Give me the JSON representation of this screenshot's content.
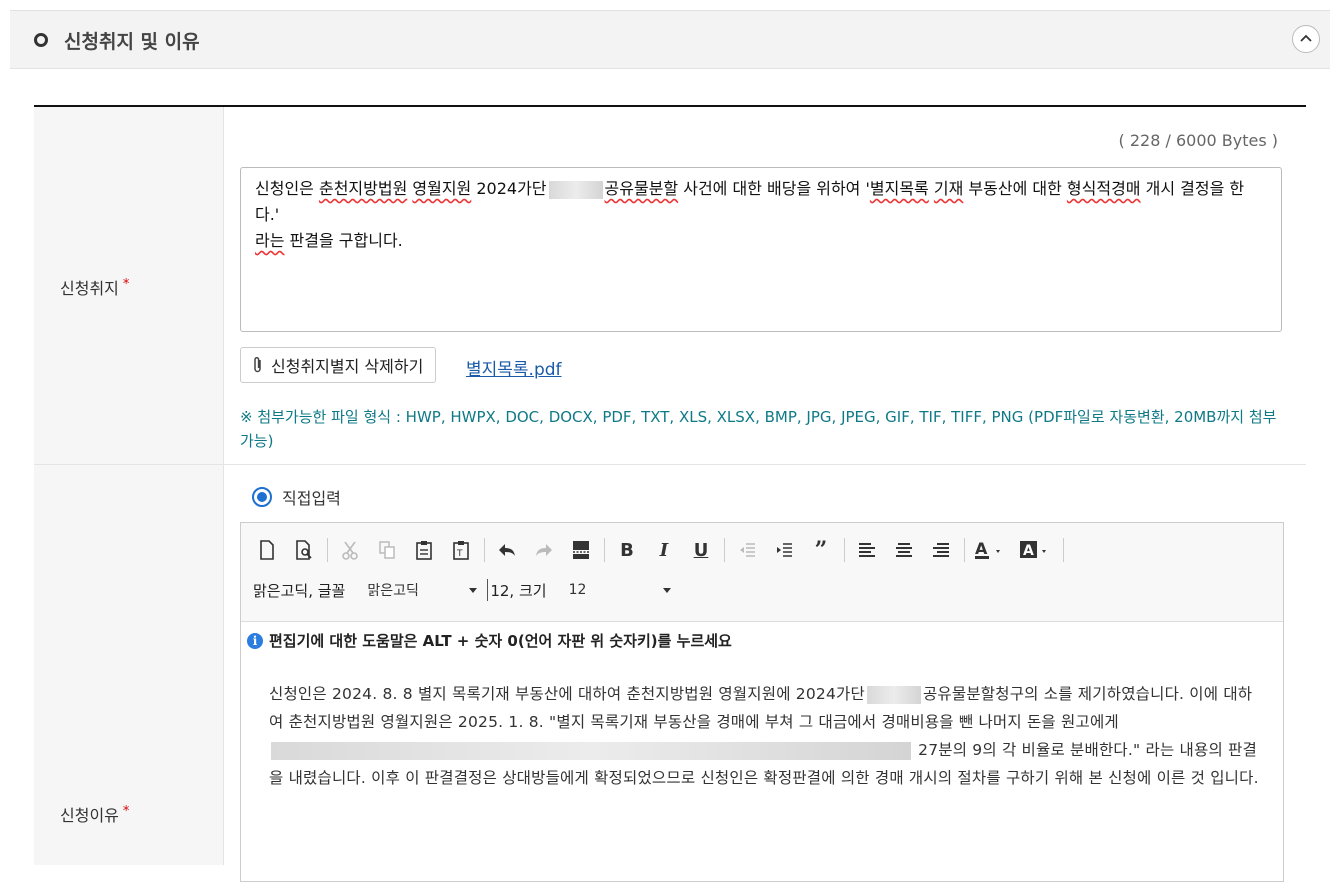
{
  "section": {
    "title": "신청취지 및 이유"
  },
  "purpose": {
    "label": "신청취지",
    "required": "*",
    "byte_counter": "( 228 / 6000 Bytes )",
    "text_a": "신청인은 ",
    "text_b": "춘천지방법원",
    "text_c": " ",
    "text_d": "영월지원",
    "text_e": " 2024가단",
    "text_f": "공유물분할",
    "text_g": " 사건에 대한 배당을 위하여 '",
    "text_h": "별지목록",
    "text_i": " ",
    "text_j": "기재",
    "text_k": " 부동산에 대한 ",
    "text_l": "형식적경매",
    "text_m": " 개시 결정을 한다.'",
    "line3_a": "라는",
    "line3_b": " 판결을 구합니다.",
    "attach_button": "신청취지별지 삭제하기",
    "file_link": "별지목록.pdf",
    "notice": "※ 첨부가능한 파일 형식 : HWP, HWPX, DOC, DOCX, PDF, TXT, XLS, XLSX, BMP, JPG, JPEG, GIF, TIF, TIFF, PNG (PDF파일로 자동변환, 20MB까지 첨부가능)"
  },
  "reason": {
    "label": "신청이유",
    "required": "*",
    "radio_label": "직접입력",
    "toolbar": {
      "font_label": "맑은고딕, 글꼴",
      "font_value": "맑은고딕",
      "size_label": "12, 크기",
      "size_value": "12"
    },
    "help_text": "편집기에 대한 도움말은 ALT + 숫자 0(언어 자판 위 숫자키)를 누르세요",
    "body_1": "신청인은 2024. 8. 8 별지 목록기재 부동산에 대하여 춘천지방법원 영월지원에 2024가단",
    "body_2": "공유물분할청구의 소를 제기하였습니다. 이에 대하여 춘천지방법원 영월지원은 2025. 1. 8. \"별지 목록기재 부동산을 경매에 부쳐 그 대금에서 경매비용을 뺀 나머지 돈을 원고에게",
    "body_3": "27분의 9의 각 비율로 분배한다.\" 라는 내용의 판결을 내렸습니다. 이후 이 판결결정은 상대방들에게 확정되었으므로 신청인은 확정판결에 의한 경매 개시의 절차를 구하기 위해 본 신청에 이른 것 입니다."
  },
  "icons": [
    "collapse-up-icon",
    "paperclip-icon",
    "info-icon",
    "new-doc-icon",
    "preview-icon",
    "cut-icon",
    "copy-icon",
    "paste-icon",
    "paste-text-icon",
    "undo-icon",
    "redo-icon",
    "page-break-icon",
    "bold-icon",
    "italic-icon",
    "underline-icon",
    "outdent-icon",
    "indent-icon",
    "blockquote-icon",
    "align-left-icon",
    "align-center-icon",
    "align-right-icon",
    "text-color-icon",
    "bg-color-icon"
  ],
  "colors": {
    "accent": "#1d6fd1",
    "link": "#1a5aa8",
    "notice": "#0f7a86",
    "required": "#dd0000"
  }
}
